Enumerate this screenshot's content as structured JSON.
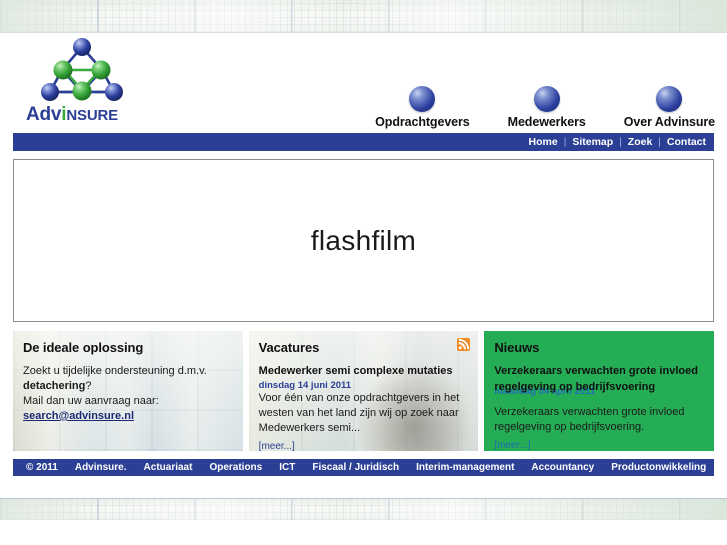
{
  "brand": {
    "name_part_1": "Adv",
    "name_part_2": "i",
    "name_part_3": "NSURE",
    "logo_icon": "molecule-logo",
    "color_blue": "#2b3f94",
    "color_green": "#3aa83a"
  },
  "mainnav": {
    "items": [
      {
        "label": "Opdrachtgevers",
        "icon": "blue-sphere-icon"
      },
      {
        "label": "Medewerkers",
        "icon": "blue-sphere-icon"
      },
      {
        "label": "Over Advinsure",
        "icon": "blue-sphere-icon"
      }
    ]
  },
  "utilitybar": {
    "items": [
      {
        "label": "Home"
      },
      {
        "label": "Sitemap"
      },
      {
        "label": "Zoek"
      },
      {
        "label": "Contact"
      }
    ],
    "separator": "|",
    "background_color": "#2b3f94"
  },
  "flash": {
    "placeholder_text": "flashfilm"
  },
  "boxes": {
    "oplossing": {
      "title": "De ideale oplossing",
      "line1": "Zoekt u tijdelijke ondersteuning d.m.v.",
      "line2_strong": "detachering",
      "line2_rest": "?",
      "line3": "Mail dan uw aanvraag naar:",
      "email": "search@advinsure.nl"
    },
    "vacatures": {
      "title": "Vacatures",
      "rss_icon": "rss-feed-icon",
      "item_title": "Medewerker semi complexe mutaties",
      "item_date": "dinsdag 14 juni 2011",
      "item_body": "Voor één van onze opdrachtgevers in het westen van het land zijn wij op zoek naar Medewerkers semi...",
      "more_label": "[meer...]"
    },
    "nieuws": {
      "title": "Nieuws",
      "background_color": "#25ad55",
      "item_title_line1": "Verzekeraars verwachten grote invloed",
      "item_title_line2": "regelgeving op bedrijfsvoering",
      "item_date": "maandag 04 april 2011",
      "item_body": "Verzekeraars verwachten grote invloed regelgeving op bedrijfsvoering.",
      "more_label": "[meer...]"
    }
  },
  "footer": {
    "copyright": "© 2011",
    "links": [
      {
        "label": "Advinsure."
      },
      {
        "label": "Actuariaat"
      },
      {
        "label": "Operations"
      },
      {
        "label": "ICT"
      },
      {
        "label": "Fiscaal / Juridisch"
      },
      {
        "label": "Interim-management"
      },
      {
        "label": "Accountancy"
      },
      {
        "label": "Productonwikkeling"
      }
    ],
    "background_color": "#2b3f94"
  }
}
